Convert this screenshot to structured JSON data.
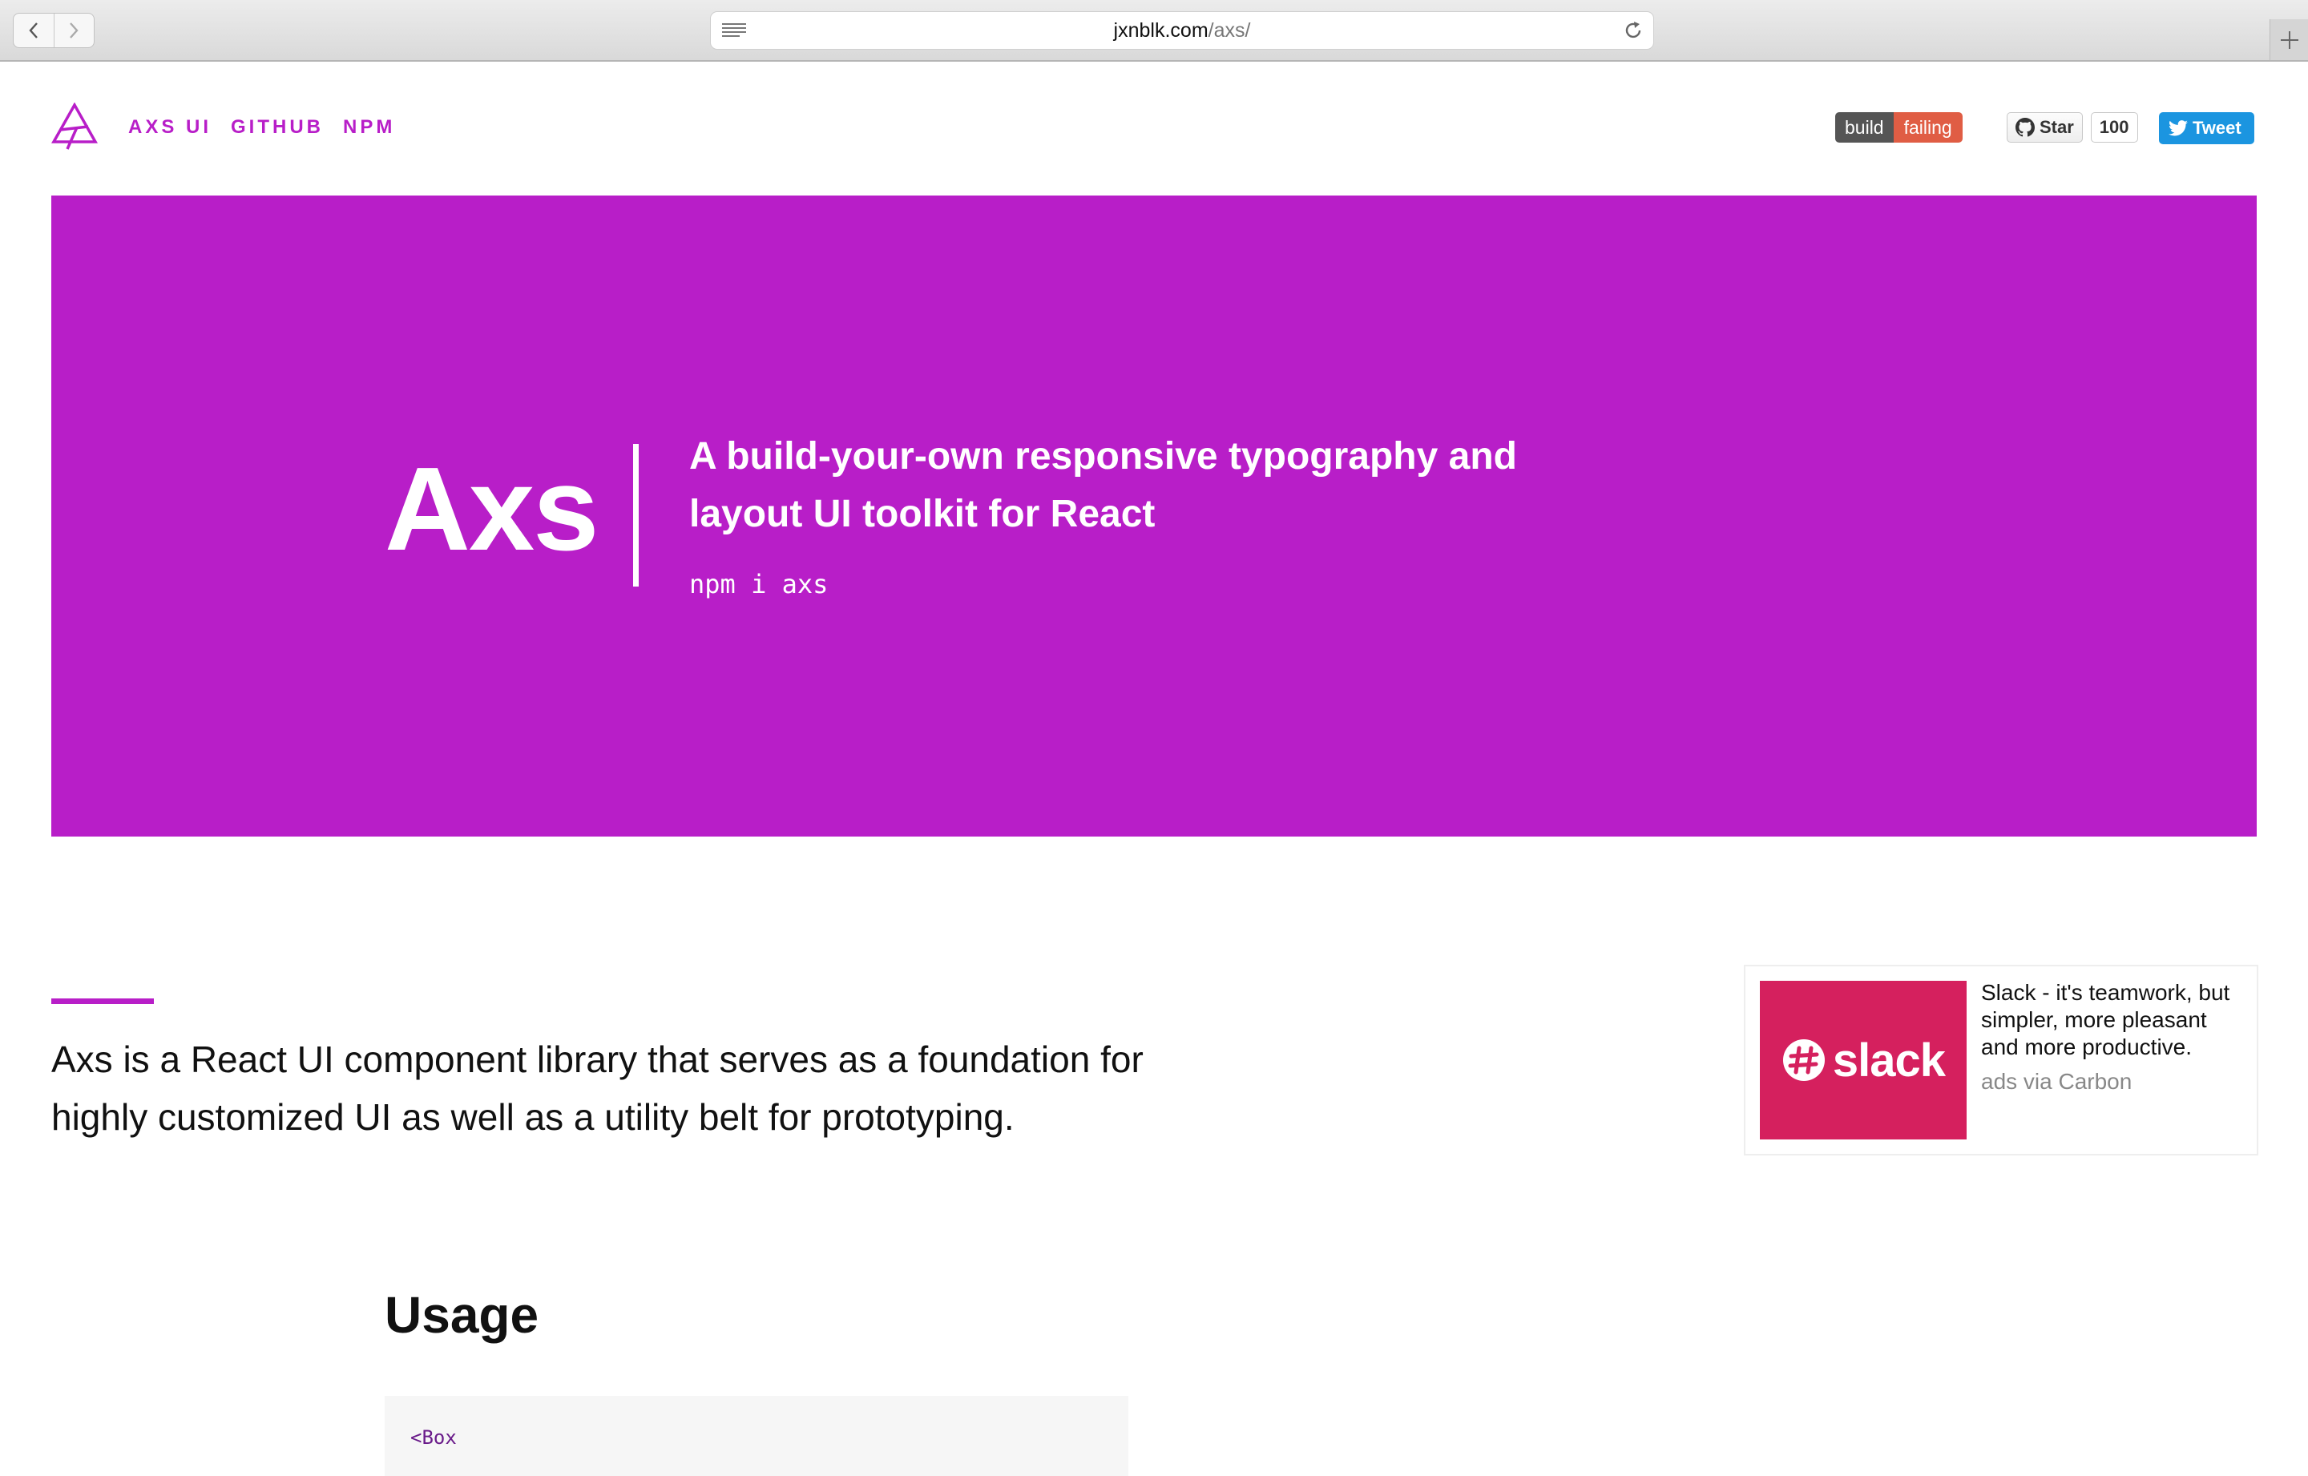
{
  "browser": {
    "url_host": "jxnblk.com",
    "url_path": "/axs/"
  },
  "nav": {
    "links": [
      {
        "label": "AXS UI"
      },
      {
        "label": "GITHUB"
      },
      {
        "label": "NPM"
      }
    ]
  },
  "badges": {
    "build_label": "build",
    "build_status": "failing",
    "github_star_label": "Star",
    "github_star_count": "100",
    "tweet_label": "Tweet"
  },
  "hero": {
    "title": "Axs",
    "tagline": "A build-your-own responsive typography and layout UI toolkit for React",
    "install_command": "npm i axs",
    "background_color": "#b81ec8"
  },
  "intro": {
    "text": "Axs is a React UI component library that serves as a foundation for highly customized UI as well as a utility belt for prototyping."
  },
  "ad": {
    "image_word": "slack",
    "text": "Slack - it's teamwork, but simpler, more pleasant and more productive.",
    "via": "ads via Carbon",
    "brand_color": "#d5205e"
  },
  "usage": {
    "heading": "Usage",
    "code_first_line": "<Box"
  },
  "colors": {
    "accent": "#b81ec8",
    "build_failing": "#e05d44",
    "tweet": "#1b95e0"
  }
}
